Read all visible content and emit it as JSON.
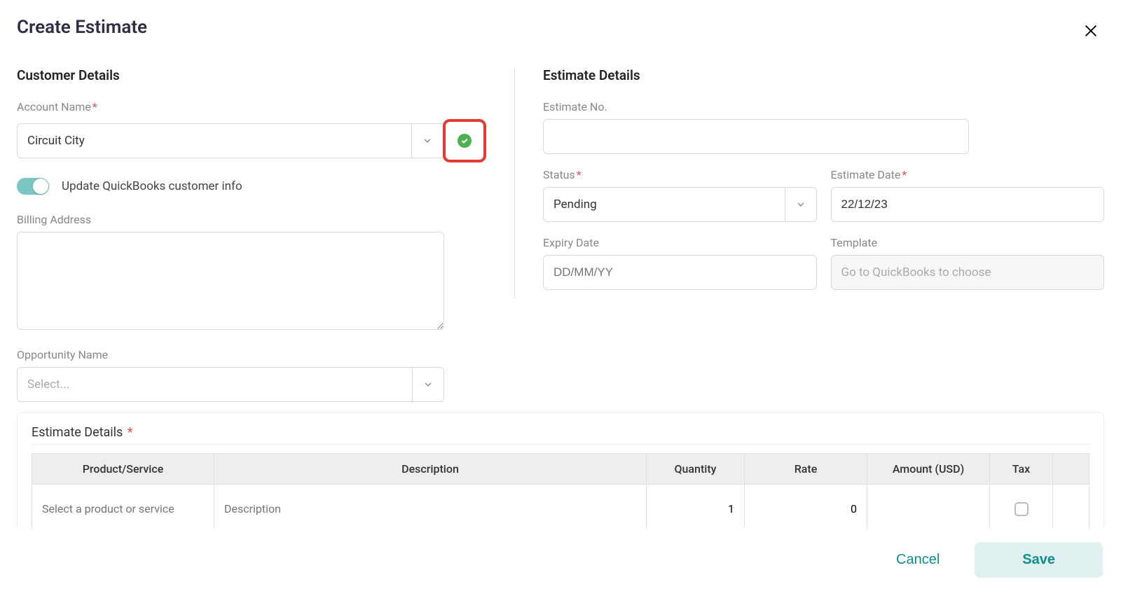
{
  "header": {
    "title": "Create Estimate"
  },
  "customer": {
    "section_title": "Customer Details",
    "account_name_label": "Account Name",
    "account_name_value": "Circuit City",
    "update_qb_label": "Update QuickBooks customer info",
    "billing_address_label": "Billing Address",
    "billing_address_value": "",
    "opportunity_label": "Opportunity Name",
    "opportunity_placeholder": "Select..."
  },
  "estimate": {
    "section_title": "Estimate Details",
    "number_label": "Estimate No.",
    "number_value": "",
    "status_label": "Status",
    "status_value": "Pending",
    "date_label": "Estimate Date",
    "date_value": "22/12/23",
    "expiry_label": "Expiry Date",
    "expiry_placeholder": "DD/MM/YY",
    "template_label": "Template",
    "template_placeholder": "Go to QuickBooks to choose"
  },
  "line_items": {
    "title": "Estimate Details",
    "columns": {
      "product": "Product/Service",
      "description": "Description",
      "quantity": "Quantity",
      "rate": "Rate",
      "amount": "Amount (USD)",
      "tax": "Tax"
    },
    "rows": [
      {
        "product_placeholder": "Select a product or service",
        "description_placeholder": "Description",
        "quantity": "1",
        "rate": "0",
        "amount": "",
        "tax": false
      }
    ]
  },
  "footer": {
    "cancel": "Cancel",
    "save": "Save"
  },
  "colors": {
    "accent": "#0e8f8f",
    "success": "#4caf50",
    "highlight": "#e53935"
  }
}
